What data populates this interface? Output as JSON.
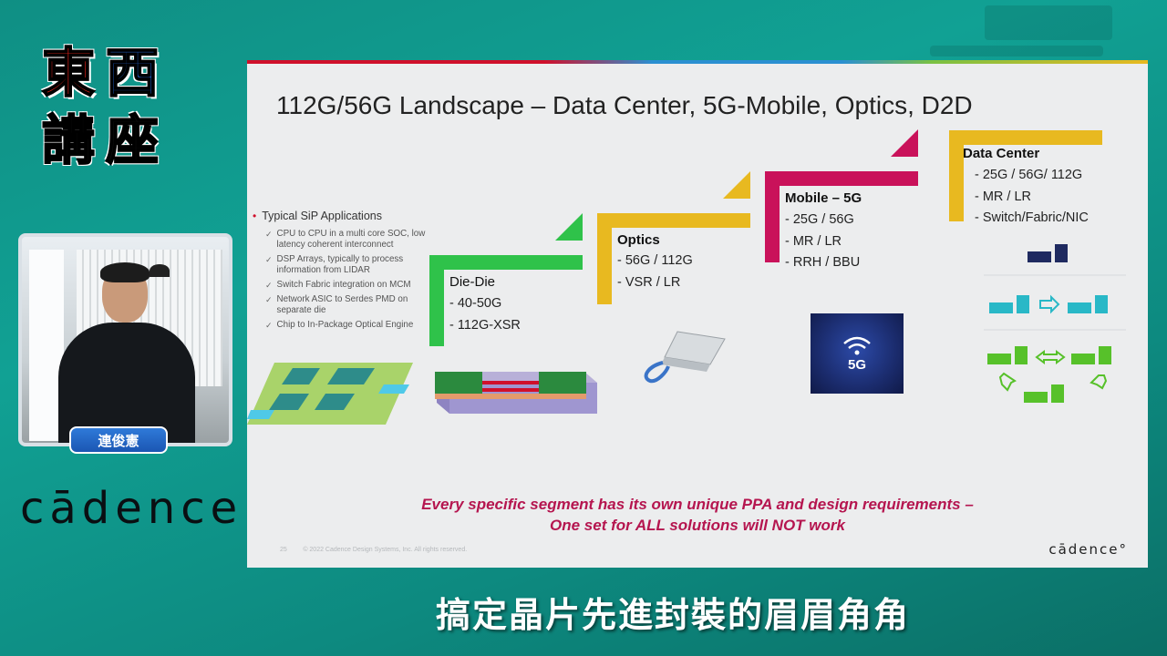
{
  "logo": {
    "char1": "東",
    "char2": "西",
    "char3": "講",
    "char4": "座"
  },
  "presenter": {
    "name": "連俊憲"
  },
  "brand": {
    "left_logo": "cādence",
    "slide_logo": "cādence°"
  },
  "slide": {
    "title": "112G/56G Landscape – Data Center, 5G-Mobile, Optics, D2D",
    "bullets": {
      "heading": "Typical  SiP Applications",
      "items": [
        "CPU to CPU in a multi core SOC, low latency coherent interconnect",
        "DSP Arrays, typically to process information from LIDAR",
        "Switch Fabric integration on MCM",
        "Network ASIC to Serdes PMD on separate die",
        "Chip to In-Package Optical Engine"
      ]
    },
    "segments": {
      "die_die": {
        "label": "Die-Die",
        "items": [
          "-   40-50G",
          "-   112G-XSR"
        ]
      },
      "optics": {
        "label": "Optics",
        "items": [
          "- 56G / 112G",
          "- VSR / LR"
        ]
      },
      "mobile": {
        "label": "Mobile – 5G",
        "items": [
          "- 25G / 56G",
          "- MR / LR",
          "- RRH / BBU"
        ]
      },
      "datacenter": {
        "label": "Data Center",
        "items": [
          "- 25G / 56G/ 112G",
          "- MR / LR",
          "- Switch/Fabric/NIC"
        ]
      }
    },
    "five_g_badge": "5G",
    "footer_line1": "Every specific segment has its own unique PPA and design requirements –",
    "footer_line2": "One set for ALL solutions will NOT work",
    "footer_small_page": "25",
    "footer_small_copy": "© 2022 Cadence Design Systems, Inc. All rights reserved.",
    "colors": {
      "green": "#2fc24a",
      "gold": "#e8b920",
      "magenta": "#c9125a",
      "accent_red": "#d0102b"
    }
  },
  "subtitle": "搞定晶片先進封裝的眉眉角角"
}
